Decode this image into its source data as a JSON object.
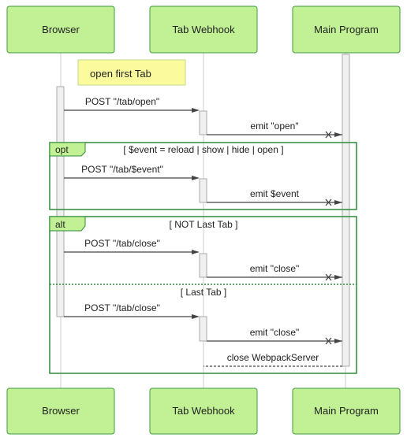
{
  "participants": [
    {
      "id": "browser",
      "label": "Browser"
    },
    {
      "id": "webhook",
      "label": "Tab Webhook"
    },
    {
      "id": "main",
      "label": "Main Program"
    }
  ],
  "note": {
    "text": "open first Tab",
    "color": "#fbfb9e"
  },
  "colors": {
    "participant_fill": "#c1f194",
    "participant_stroke": "#3f9b3f",
    "frame_stroke": "#2e8b3a",
    "activation_fill": "#f0f0f0"
  },
  "frames": {
    "opt": {
      "keyword": "opt",
      "guard": "[ $event = reload | show | hide | open ]"
    },
    "alt": {
      "keyword": "alt",
      "guard": "[ NOT Last Tab ]",
      "else_guard": "[ Last Tab ]"
    }
  },
  "messages": [
    {
      "from": "browser",
      "to": "webhook",
      "label": "POST \"/tab/open\"",
      "style": "solid"
    },
    {
      "from": "webhook",
      "to": "main",
      "label": "emit \"open\"",
      "style": "solid-x"
    },
    {
      "from": "browser",
      "to": "webhook",
      "label": "POST \"/tab/$event\"",
      "style": "solid"
    },
    {
      "from": "webhook",
      "to": "main",
      "label": "emit $event",
      "style": "solid-x"
    },
    {
      "from": "browser",
      "to": "webhook",
      "label": "POST \"/tab/close\"",
      "style": "solid"
    },
    {
      "from": "webhook",
      "to": "main",
      "label": "emit \"close\"",
      "style": "solid-x"
    },
    {
      "from": "browser",
      "to": "webhook",
      "label": "POST \"/tab/close\"",
      "style": "solid"
    },
    {
      "from": "webhook",
      "to": "main",
      "label": "emit \"close\"",
      "style": "solid-x"
    },
    {
      "from": "main",
      "to": "webhook",
      "label": "close WebpackServer",
      "style": "dashed"
    }
  ]
}
